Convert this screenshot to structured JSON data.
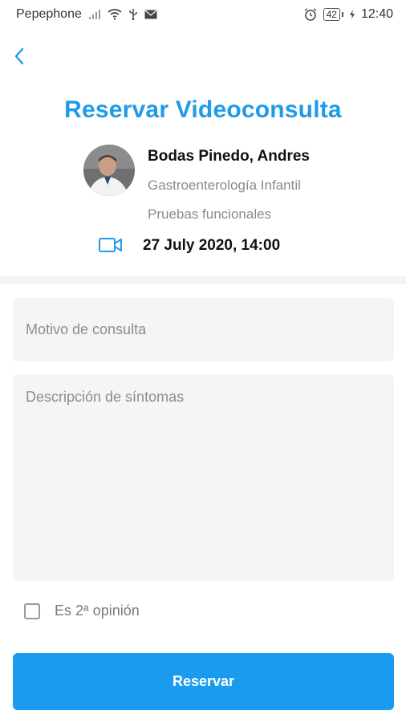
{
  "status_bar": {
    "carrier": "Pepephone",
    "battery": "42",
    "time": "12:40",
    "icons": [
      "signal-icon",
      "wifi-icon",
      "usb-icon",
      "mail-icon",
      "alarm-icon",
      "battery-icon",
      "charging-icon"
    ]
  },
  "header": {
    "back_icon": "chevron-left-icon",
    "title": "Reservar Videoconsulta"
  },
  "doctor": {
    "name": "Bodas Pinedo, Andres",
    "specialty": "Gastroenterología Infantil",
    "service": "Pruebas funcionales",
    "avatar": "doctor-photo"
  },
  "appointment": {
    "icon": "video-camera-icon",
    "datetime": "27 July 2020, 14:00"
  },
  "form": {
    "motivo_placeholder": "Motivo de consulta",
    "motivo_value": "",
    "sintomas_placeholder": "Descripción de síntomas",
    "sintomas_value": "",
    "second_opinion_label": "Es 2ª opinión",
    "second_opinion_checked": false,
    "submit_label": "Reservar"
  },
  "colors": {
    "accent": "#1f9be8",
    "button": "#1a9bf0",
    "field_background": "#f5f5f5",
    "muted_text": "#8a8a8a"
  }
}
